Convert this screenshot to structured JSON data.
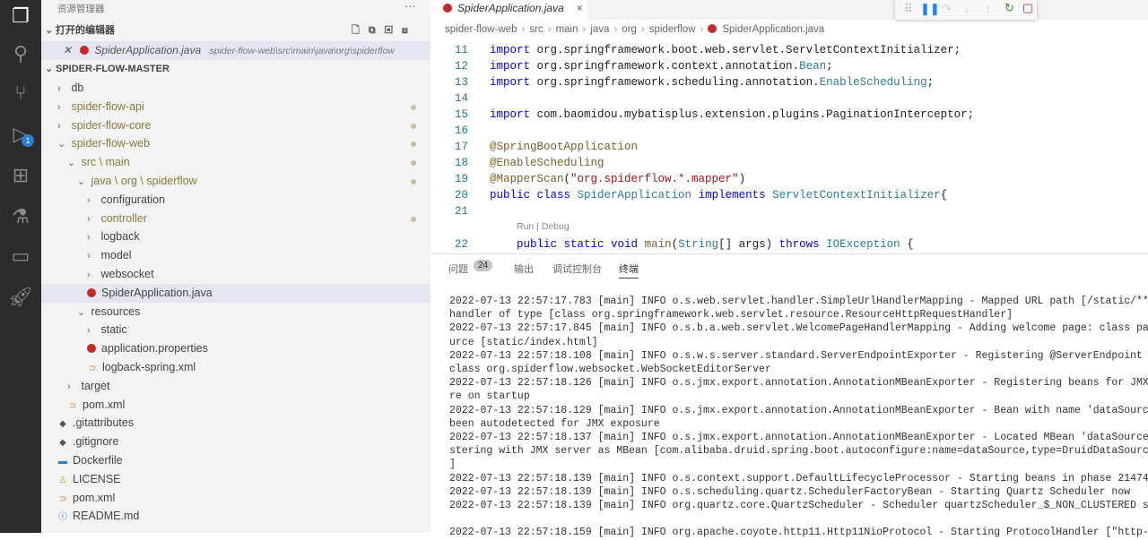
{
  "activity": {
    "badge": "1"
  },
  "explorer": {
    "title": "资源管理器",
    "more": "···",
    "open_editors_label": "打开的编辑器",
    "open_editor": {
      "name": "SpiderApplication.java",
      "path": "spider-flow-web\\src\\main\\java\\org\\spiderflow"
    },
    "root": "SPIDER-FLOW-MASTER",
    "tree": [
      {
        "label": "db",
        "indent": 0,
        "kind": "folder",
        "open": false
      },
      {
        "label": "spider-flow-api",
        "indent": 0,
        "kind": "folder",
        "open": false,
        "mod": true
      },
      {
        "label": "spider-flow-core",
        "indent": 0,
        "kind": "folder",
        "open": false,
        "mod": true
      },
      {
        "label": "spider-flow-web",
        "indent": 0,
        "kind": "folder",
        "open": true,
        "mod": true
      },
      {
        "label": "src \\ main",
        "indent": 1,
        "kind": "folder",
        "open": true,
        "mod": true
      },
      {
        "label": "java \\ org \\ spiderflow",
        "indent": 2,
        "kind": "folder",
        "open": true,
        "mod": true
      },
      {
        "label": "configuration",
        "indent": 3,
        "kind": "folder",
        "open": false
      },
      {
        "label": "controller",
        "indent": 3,
        "kind": "folder",
        "open": false,
        "mod": true
      },
      {
        "label": "logback",
        "indent": 3,
        "kind": "folder",
        "open": false
      },
      {
        "label": "model",
        "indent": 3,
        "kind": "folder",
        "open": false
      },
      {
        "label": "websocket",
        "indent": 3,
        "kind": "folder",
        "open": false
      },
      {
        "label": "SpiderApplication.java",
        "indent": 3,
        "kind": "java",
        "selected": true
      },
      {
        "label": "resources",
        "indent": 2,
        "kind": "folder",
        "open": true
      },
      {
        "label": "static",
        "indent": 3,
        "kind": "folder",
        "open": false
      },
      {
        "label": "application.properties",
        "indent": 3,
        "kind": "java"
      },
      {
        "label": "logback-spring.xml",
        "indent": 3,
        "kind": "xml"
      },
      {
        "label": "target",
        "indent": 1,
        "kind": "folder",
        "open": false
      },
      {
        "label": "pom.xml",
        "indent": 1,
        "kind": "xml"
      },
      {
        "label": ".gitattributes",
        "indent": 0,
        "kind": "git"
      },
      {
        "label": ".gitignore",
        "indent": 0,
        "kind": "git"
      },
      {
        "label": "Dockerfile",
        "indent": 0,
        "kind": "docker"
      },
      {
        "label": "LICENSE",
        "indent": 0,
        "kind": "license"
      },
      {
        "label": "pom.xml",
        "indent": 0,
        "kind": "xml"
      },
      {
        "label": "README.md",
        "indent": 0,
        "kind": "info"
      }
    ]
  },
  "editor": {
    "tab": "SpiderApplication.java",
    "tab_close": "×",
    "breadcrumb": [
      "spider-flow-web",
      "src",
      "main",
      "java",
      "org",
      "spiderflow",
      "SpiderApplication.java"
    ],
    "codelens": "Run | Debug",
    "lines": [
      {
        "n": "11",
        "html": "<span class='kw'>import</span> org.springframework.boot.web.servlet.ServletContextInitializer;"
      },
      {
        "n": "12",
        "html": "<span class='kw'>import</span> org.springframework.context.annotation.<span class='ty'>Bean</span>;"
      },
      {
        "n": "13",
        "html": "<span class='kw'>import</span> org.springframework.scheduling.annotation.<span class='ty'>EnableScheduling</span>;"
      },
      {
        "n": "14",
        "html": ""
      },
      {
        "n": "15",
        "html": "<span class='kw'>import</span> com.baomidou.mybatisplus.extension.plugins.PaginationInterceptor;"
      },
      {
        "n": "16",
        "html": ""
      },
      {
        "n": "17",
        "html": "<span class='an'>@SpringBootApplication</span>"
      },
      {
        "n": "18",
        "html": "<span class='an'>@EnableScheduling</span>"
      },
      {
        "n": "19",
        "html": "<span class='an'>@MapperScan</span>(<span class='str'>\"org.spiderflow.*.mapper\"</span>)"
      },
      {
        "n": "20",
        "html": "<span class='kw'>public class</span> <span class='ty'>SpiderApplication</span> <span class='kw'>implements</span> <span class='ty'>ServletContextInitializer</span>{"
      },
      {
        "n": "21",
        "html": ""
      },
      {
        "n": "22",
        "html": "    <span class='kw'>public static void</span> <span class='an'>main</span>(<span class='ty'>String</span>[] args) <span class='kw'>throws</span> <span class='ty'>IOException</span> {"
      }
    ]
  },
  "panel": {
    "tabs": [
      "问题",
      "输出",
      "调试控制台",
      "终端"
    ],
    "problems_count": "24",
    "log": [
      "2022-07-13 22:57:17.783 [main] INFO  o.s.web.servlet.handler.SimpleUrlHandlerMapping - Mapped URL path [/static/**",
      "handler of type [class org.springframework.web.servlet.resource.ResourceHttpRequestHandler]",
      "2022-07-13 22:57:17.845 [main] INFO  o.s.b.a.web.servlet.WelcomePageHandlerMapping - Adding welcome page: class pa",
      "urce [static/index.html]",
      "2022-07-13 22:57:18.108 [main] INFO  o.s.w.s.server.standard.ServerEndpointExporter - Registering @ServerEndpoint",
      "class org.spiderflow.websocket.WebSocketEditorServer",
      "2022-07-13 22:57:18.126 [main] INFO  o.s.jmx.export.annotation.AnnotationMBeanExporter - Registering beans for JMX",
      "re on startup",
      "2022-07-13 22:57:18.129 [main] INFO  o.s.jmx.export.annotation.AnnotationMBeanExporter - Bean with name 'dataSourc",
      "been autodetected for JMX exposure",
      "2022-07-13 22:57:18.137 [main] INFO  o.s.jmx.export.annotation.AnnotationMBeanExporter - Located MBean 'dataSource",
      "stering with JMX server as MBean [com.alibaba.druid.spring.boot.autoconfigure:name=dataSource,type=DruidDataSource",
      "]",
      "2022-07-13 22:57:18.139 [main] INFO  o.s.context.support.DefaultLifecycleProcessor - Starting beans in phase 21474",
      "2022-07-13 22:57:18.139 [main] INFO  o.s.scheduling.quartz.SchedulerFactoryBean - Starting Quartz Scheduler now",
      "2022-07-13 22:57:18.139 [main] INFO  org.quartz.core.QuartzScheduler - Scheduler quartzScheduler_$_NON_CLUSTERED s",
      "",
      "2022-07-13 22:57:18.159 [main] INFO  org.apache.coyote.http11.Http11NioProtocol - Starting ProtocolHandler [\"http-"
    ]
  }
}
